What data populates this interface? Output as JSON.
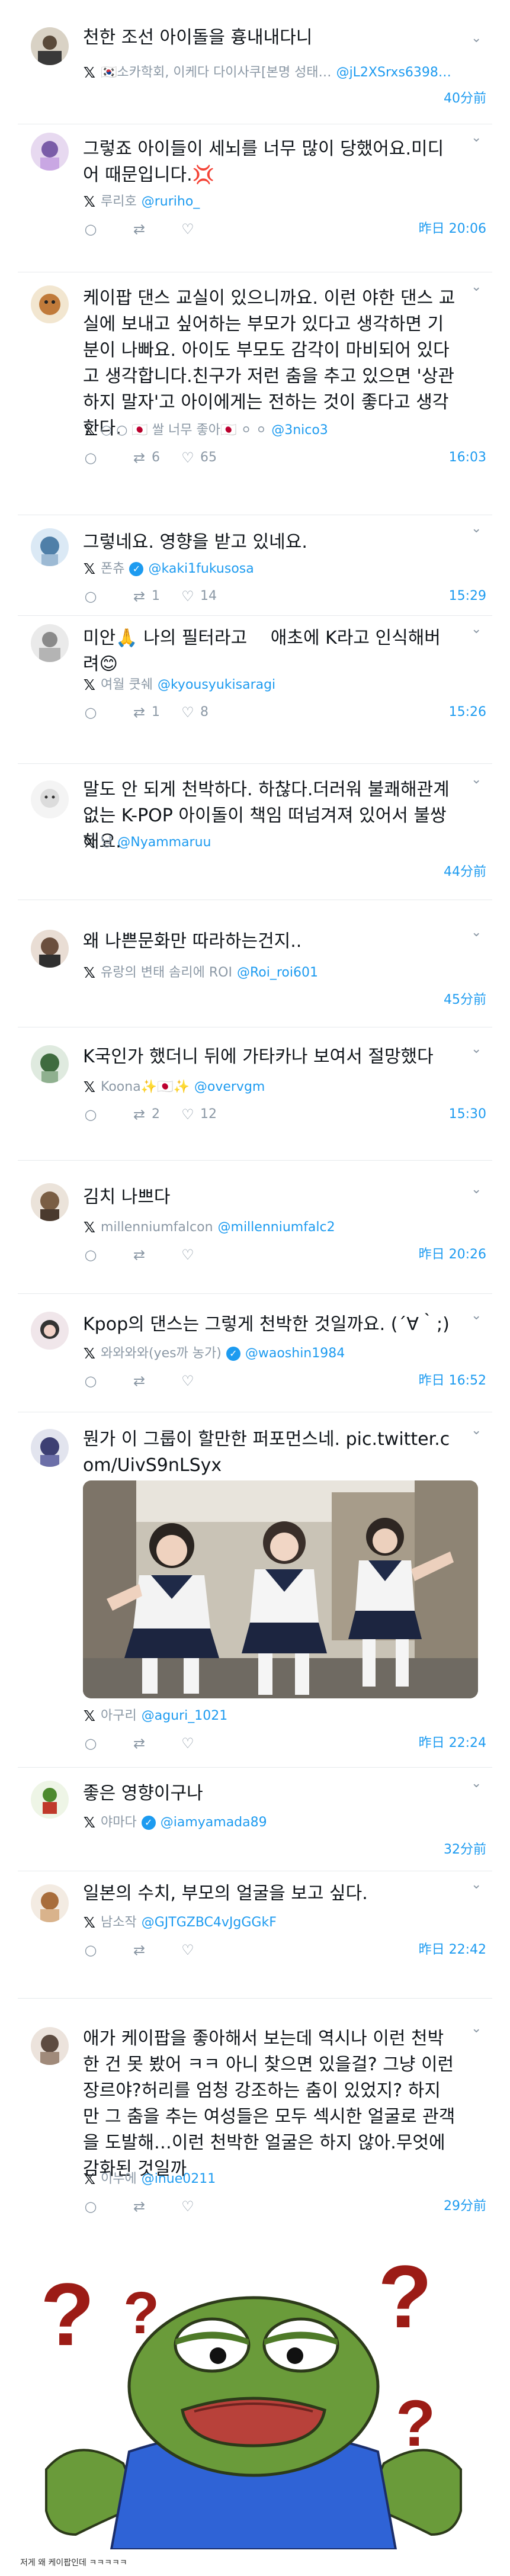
{
  "tweets": [
    {
      "text": "천한 조선 아이돌을 흉내내다니",
      "username": "🇰🇷소카학회, 이케다 다이사쿠[본명 성태…",
      "handle": "@jL2XSrxs6398…",
      "verified": false,
      "replies": "",
      "retweets": "",
      "likes": "",
      "time": "40分前"
    },
    {
      "text": "그렇죠 아이들이 세뇌를 너무 많이 당했어요.미디어 때문입니다.💢",
      "username": "루리호",
      "handle": "@ruriho_",
      "verified": false,
      "replies": "",
      "retweets": "",
      "likes": "",
      "time": "昨日 20:06"
    },
    {
      "text": "케이팝 댄스 교실이 있으니까요. 이런 야한 댄스 교실에 보내고 싶어하는 부모가 있다고 생각하면 기분이 나빠요. 아이도 부모도 감각이 마비되어 있다고 생각합니다.친구가 저런 춤을 추고 있으면 '상관하지 말자'고 아이에게는 전하는 것이 좋다고 생각한다.",
      "username": "○ ○ 🇯🇵 쌀 너무 좋아🇯🇵 ⚪ ⚪",
      "handle": "@3nico3",
      "verified": false,
      "replies": "",
      "retweets": "6",
      "likes": "65",
      "time": "16:03"
    },
    {
      "text": "그렇네요. 영향을 받고 있네요.",
      "username": "폰츄",
      "handle": "@kaki1fukusosa",
      "verified": true,
      "replies": "",
      "retweets": "1",
      "likes": "14",
      "time": "15:29"
    },
    {
      "text": "미안🙏 나의 필터라고　 애초에 K라고 인식해버려😊",
      "username": "여월 쿳쉐",
      "handle": "@kyousyukisaragi",
      "verified": false,
      "replies": "",
      "retweets": "1",
      "likes": "8",
      "time": "15:26"
    },
    {
      "text": "말도 안 되게 천박하다. 하찮다.더러워 불쾌해관계없는 K-POP 아이돌이 책임 떠넘겨져 있어서 불쌍해요.",
      "username": "냥",
      "handle": "@Nyammaruu",
      "verified": false,
      "replies": "",
      "retweets": "",
      "likes": "",
      "time": "44分前"
    },
    {
      "text": "왜 나쁜문화만 따라하는건지..",
      "username": "유랑의 변태 솜리에 ROI",
      "handle": "@Roi_roi601",
      "verified": false,
      "replies": "",
      "retweets": "",
      "likes": "",
      "time": "45分前"
    },
    {
      "text": "K국인가 했더니 뒤에 가타카나 보여서 절망했다",
      "username": "Koona✨🇯🇵✨",
      "handle": "@overvgm",
      "verified": false,
      "replies": "",
      "retweets": "2",
      "likes": "12",
      "time": "15:30"
    },
    {
      "text": "김치 나쁘다",
      "username": "millenniumfalcon",
      "handle": "@millenniumfalc2",
      "verified": false,
      "replies": "",
      "retweets": "",
      "likes": "",
      "time": "昨日 20:26"
    },
    {
      "text": "Kpop의 댄스는 그렇게 천박한 것일까요. (´∀｀;)",
      "username": "와와와와(yes까 농가)",
      "handle": "@waoshin1984",
      "verified": true,
      "replies": "",
      "retweets": "",
      "likes": "",
      "time": "昨日 16:52"
    },
    {
      "text": "뭔가 이 그룹이 할만한 퍼포먼스네. pic.twitter.com/UivS9nLSyx",
      "username": "아구리",
      "handle": "@aguri_1021",
      "verified": false,
      "replies": "",
      "retweets": "",
      "likes": "",
      "time": "昨日 22:24"
    },
    {
      "text": "좋은 영향이구나",
      "username": "야마다",
      "handle": "@iamyamada89",
      "verified": true,
      "replies": "",
      "retweets": "",
      "likes": "",
      "time": "32分前"
    },
    {
      "text": "일본의 수치, 부모의 얼굴을 보고 싶다.",
      "username": "남소작",
      "handle": "@GJTGZBC4vJgGGkF",
      "verified": false,
      "replies": "",
      "retweets": "",
      "likes": "",
      "time": "昨日 22:42"
    },
    {
      "text": "애가 케이팝을 좋아해서 보는데 역시나 이런 천박한 건 못 봤어 ㅋㅋ 아니 찾으면 있을걸? 그냥 이런 장르야?허리를 엄청 강조하는 춤이 있었지? 하지만 그 춤을 추는 여성들은 모두 섹시한 얼굴로 관객을 도발해…이런 천박한 얼굴은 하지 않아.무엇에 감화된 것일까",
      "username": "이누에",
      "handle": "@inue0211",
      "verified": false,
      "replies": "",
      "retweets": "",
      "likes": "",
      "time": "29分前"
    }
  ],
  "meme": {
    "marks": "? ? ? ?"
  },
  "footer": {
    "caption": "저게 왜 케이팝인데 ㅋㅋㅋㅋㅋ"
  },
  "colors": {
    "link": "#1d9bf0",
    "muted": "#8b98a5",
    "divider": "#e6e9ec"
  }
}
